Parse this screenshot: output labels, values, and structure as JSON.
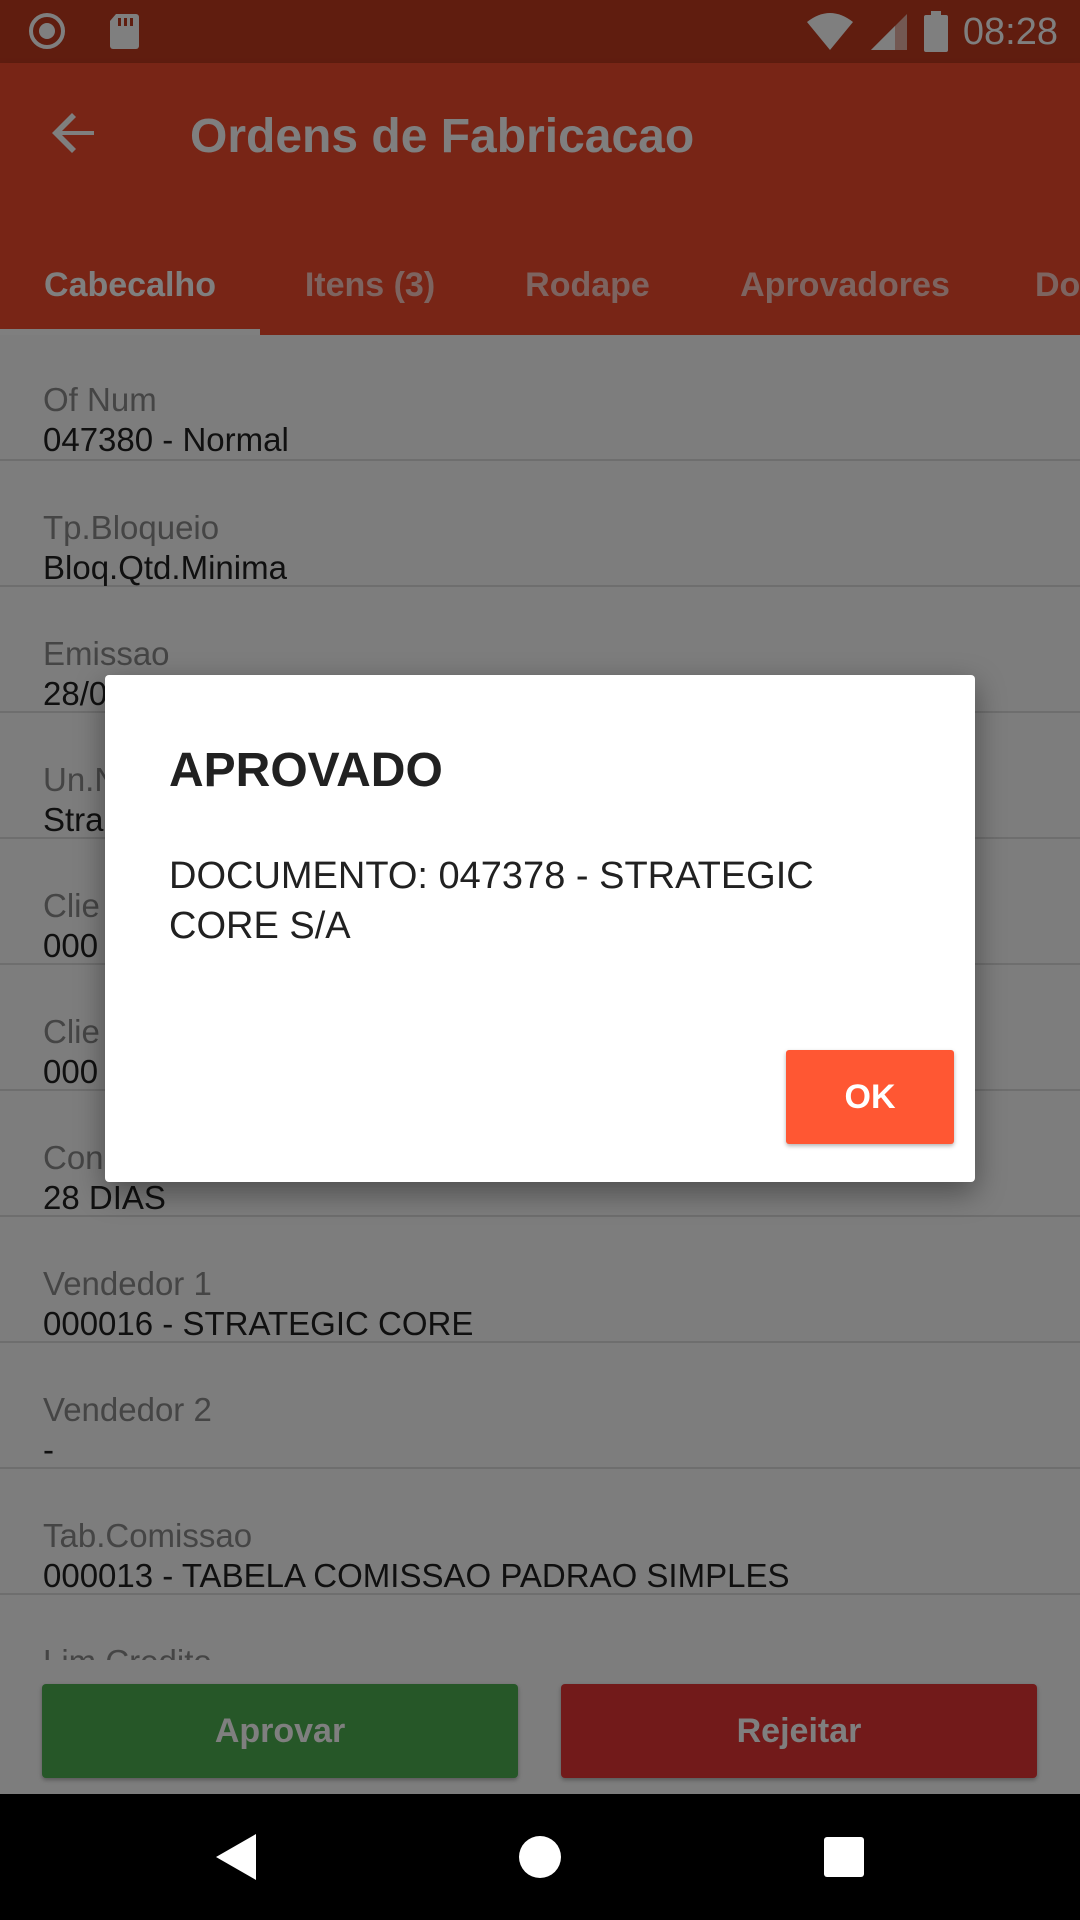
{
  "status_bar": {
    "time": "08:28",
    "icons": [
      "record-icon",
      "sd-card-icon",
      "wifi-icon",
      "signal-icon",
      "battery-icon"
    ]
  },
  "app_bar": {
    "title": "Ordens de Fabricacao",
    "back_icon": "arrow-back-icon"
  },
  "tabs": [
    {
      "label": "Cabecalho",
      "active": true
    },
    {
      "label": "Itens (3)"
    },
    {
      "label": "Rodape"
    },
    {
      "label": "Aprovadores"
    },
    {
      "label": "Doc"
    }
  ],
  "fields": [
    {
      "label": "Of Num",
      "value": "047380 - Normal"
    },
    {
      "label": "Tp.Bloqueio",
      "value": "Bloq.Qtd.Minima"
    },
    {
      "label": "Emissao",
      "value": "28/0"
    },
    {
      "label": "Un.N",
      "value": "Stra"
    },
    {
      "label": "Clie",
      "value": "000"
    },
    {
      "label": "Clie",
      "value": "000"
    },
    {
      "label": "Con",
      "value": "28 DIAS"
    },
    {
      "label": "Vendedor 1",
      "value": "000016 - STRATEGIC CORE"
    },
    {
      "label": "Vendedor 2",
      "value": "-"
    },
    {
      "label": "Tab.Comissao",
      "value": "000013 - TABELA COMISSAO PADRAO SIMPLES"
    },
    {
      "label": "Lim.Credito",
      "value": ""
    }
  ],
  "actions": {
    "approve": "Aprovar",
    "reject": "Rejeitar"
  },
  "dialog": {
    "title": "APROVADO",
    "message": "DOCUMENTO: 047378 - STRATEGIC CORE S/A",
    "ok": "OK"
  },
  "colors": {
    "primary": "#f14b2c",
    "status": "#c13a1f",
    "approve": "#4cae50",
    "reject": "#e53535",
    "dialog_ok": "#ff5733"
  }
}
